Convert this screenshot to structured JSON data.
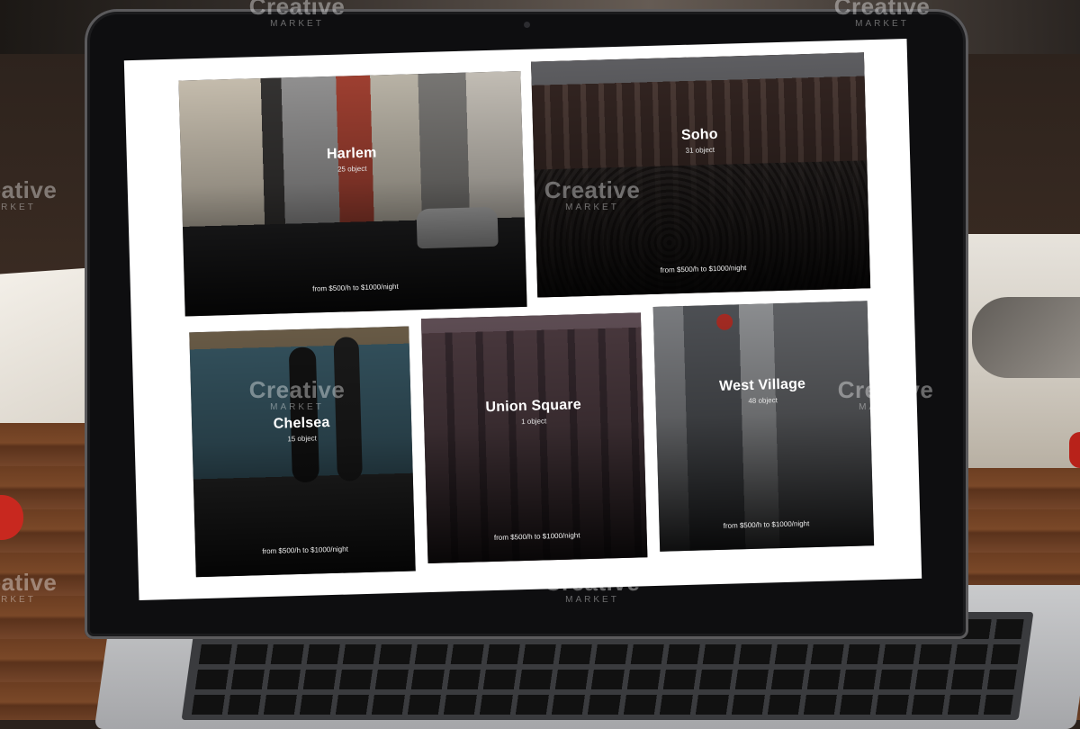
{
  "watermark": {
    "brand": "Creative",
    "sub": "MARKET"
  },
  "cards": {
    "harlem": {
      "title": "Harlem",
      "count": "25 object",
      "price": "from $500/h to $1000/night"
    },
    "soho": {
      "title": "Soho",
      "count": "31 object",
      "price": "from $500/h to $1000/night"
    },
    "chelsea": {
      "title": "Chelsea",
      "count": "15 object",
      "price": "from $500/h to $1000/night"
    },
    "union": {
      "title": "Union Square",
      "count": "1 object",
      "price": "from $500/h to $1000/night"
    },
    "westvillage": {
      "title": "West Village",
      "count": "48 object",
      "price": "from $500/h to $1000/night"
    }
  },
  "icons": [
    "camera-dot"
  ],
  "colors": {
    "screen_bg": "#ffffff",
    "bezel": "#0e0e10",
    "text": "#ffffff"
  }
}
